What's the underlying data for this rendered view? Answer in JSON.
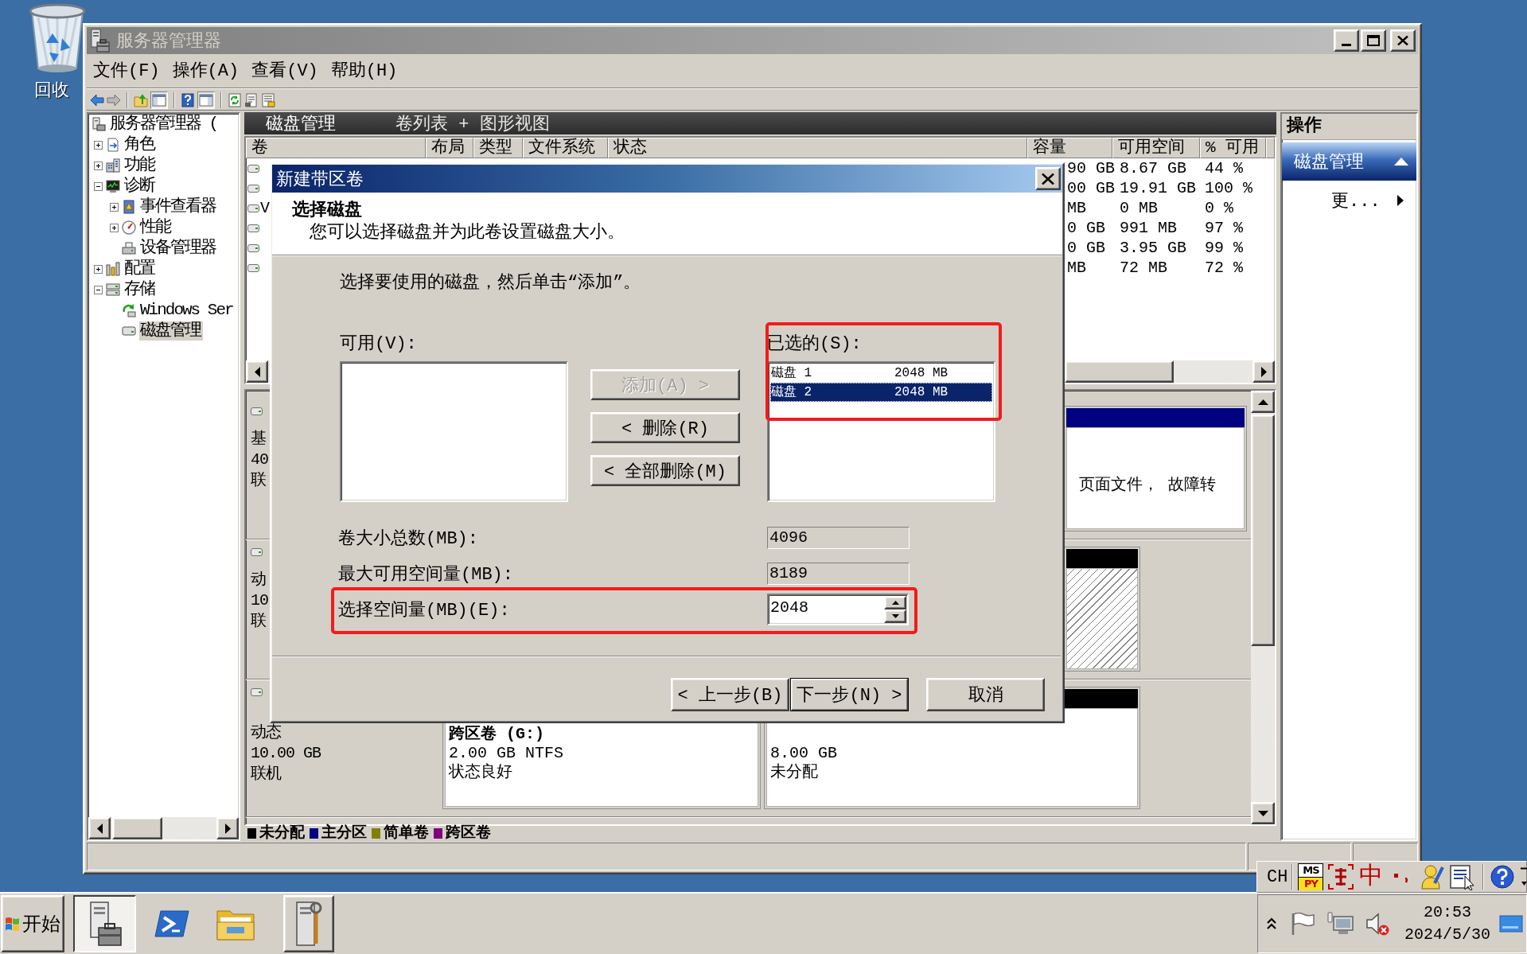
{
  "desktop": {
    "icons": [
      {
        "label": "回收"
      }
    ]
  },
  "window": {
    "title": "服务器管理器",
    "active": false,
    "menu": [
      "文件(F)",
      "操作(A)",
      "查看(V)",
      "帮助(H)"
    ],
    "toolbar": {
      "console_tree_shown": true,
      "action_pane_shown": true
    },
    "tree": [
      {
        "label": "服务器管理器 (",
        "selected": false,
        "children": [
          {
            "label": "角色",
            "kind": "branch",
            "expanded": false,
            "selected": false
          },
          {
            "label": "功能",
            "kind": "branch",
            "expanded": false,
            "selected": false
          },
          {
            "label": "诊断",
            "kind": "branch",
            "expanded": true,
            "selected": false,
            "children": [
              {
                "label": "事件查看器",
                "kind": "branch",
                "expanded": false,
                "selected": false
              },
              {
                "label": "性能",
                "kind": "branch",
                "expanded": false,
                "selected": false
              },
              {
                "label": "设备管理器",
                "kind": "leaf",
                "selected": false
              }
            ]
          },
          {
            "label": "配置",
            "kind": "branch",
            "expanded": false,
            "selected": false
          },
          {
            "label": "存储",
            "kind": "branch",
            "expanded": true,
            "selected": false,
            "children": [
              {
                "label": "Windows Ser",
                "kind": "leaf",
                "selected": false
              },
              {
                "label": "磁盘管理",
                "kind": "leaf",
                "selected": true
              }
            ]
          }
        ]
      }
    ],
    "details": {
      "title": "磁盘管理",
      "view": "卷列表 + 图形视图",
      "columns": [
        "卷",
        "布局",
        "类型",
        "文件系统",
        "状态",
        "容量",
        "可用空间",
        "% 可用"
      ],
      "rows": [
        {
          "capacity": "90 GB",
          "free_space": "8.67 GB",
          "percent_free": "44 %"
        },
        {
          "capacity": "00 GB",
          "free_space": "19.91 GB",
          "percent_free": "100 %"
        },
        {
          "volume": "V",
          "capacity": "MB",
          "free_space": "0 MB",
          "percent_free": "0 %"
        },
        {
          "capacity": "0 GB",
          "free_space": "991 MB",
          "percent_free": "97 %"
        },
        {
          "capacity": "0 GB",
          "free_space": "3.95 GB",
          "percent_free": "99 %"
        },
        {
          "capacity": "MB",
          "free_space": "72 MB",
          "percent_free": "72 %"
        }
      ],
      "disks": [
        {
          "type": "基",
          "size": "40",
          "status": "联",
          "partitions": [
            {
              "color": "#000080",
              "selected": false,
              "status": "页面文件， 故障转"
            }
          ]
        },
        {
          "type": "动",
          "size": "10",
          "status": "联",
          "partitions": [
            {
              "color": "#000000",
              "selected": true
            }
          ]
        },
        {
          "type": "动态",
          "size": "10.00 GB",
          "status": "联机",
          "partitions": [
            {
              "selected": false,
              "name": "跨区卷 (G:)",
              "size": "2.00 GB NTFS",
              "status": "状态良好"
            },
            {
              "color": "#000000",
              "selected": false,
              "size": "8.00 GB",
              "status": "未分配"
            }
          ]
        }
      ],
      "legend": [
        {
          "label": "未分配",
          "color": "#000000"
        },
        {
          "label": "主分区",
          "color": "#000080"
        },
        {
          "label": "简单卷",
          "color": "#808000"
        },
        {
          "label": "跨区卷",
          "color": "#800080"
        }
      ]
    },
    "actions": {
      "title": "操作",
      "section": "磁盘管理",
      "section_expanded": true,
      "items": [
        "更..."
      ]
    }
  },
  "dialog": {
    "title": "新建带区卷",
    "active": true,
    "heading": "选择磁盘",
    "subheading": "您可以选择磁盘并为此卷设置磁盘大小。",
    "instruction": "选择要使用的磁盘，然后单击“添加”。",
    "available": {
      "label": "可用(V):"
    },
    "move_buttons": [
      {
        "label": "添加(A) >",
        "disabled": true
      },
      {
        "label": "< 删除(R)",
        "disabled": false
      },
      {
        "label": "< 全部删除(M)",
        "disabled": false
      }
    ],
    "selected_disks": {
      "label": "已选的(S):",
      "highlighted": true,
      "items": [
        {
          "name": "磁盘 1",
          "size": "2048 MB",
          "selected": false
        },
        {
          "name": "磁盘 2",
          "size": "2048 MB",
          "selected": true
        }
      ]
    },
    "size_fields": [
      {
        "label": "卷大小总数(MB):",
        "value": "4096",
        "kind": "readonly",
        "highlighted": false
      },
      {
        "label": "最大可用空间量(MB):",
        "value": "8189",
        "kind": "readonly",
        "highlighted": false
      },
      {
        "label": "选择空间量(MB)(E):",
        "value": "2048",
        "kind": "spinner",
        "highlighted": true
      }
    ],
    "buttons": [
      {
        "label": "< 上一步(B)",
        "default": false
      },
      {
        "label": "下一步(N) >",
        "default": true
      },
      {
        "label": "取消",
        "default": false
      }
    ]
  },
  "language_bar": {
    "language": "CH",
    "ime_logo": [
      "MS",
      "PY"
    ],
    "input_mode": "中"
  },
  "taskbar": {
    "start": "开始",
    "apps": [
      {
        "kind": "window",
        "active": true
      },
      {
        "kind": "launcher",
        "active": false
      },
      {
        "kind": "launcher",
        "active": false
      },
      {
        "kind": "window",
        "active": false
      }
    ],
    "clock": {
      "time": "20:53",
      "date": "2024/5/30"
    }
  }
}
